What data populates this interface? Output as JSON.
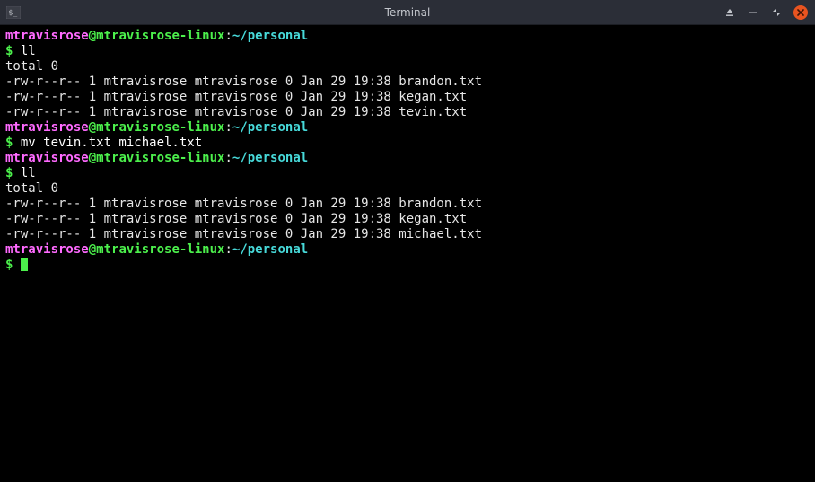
{
  "window": {
    "title": "Terminal"
  },
  "prompt": {
    "user": "mtravisrose",
    "at": "@",
    "host": "mtravisrose-linux",
    "sep": ":",
    "path": "~/personal",
    "dollar": "$"
  },
  "session": {
    "blocks": [
      {
        "cmd": "ll",
        "output": [
          "total 0",
          "-rw-r--r-- 1 mtravisrose mtravisrose 0 Jan 29 19:38 brandon.txt",
          "-rw-r--r-- 1 mtravisrose mtravisrose 0 Jan 29 19:38 kegan.txt",
          "-rw-r--r-- 1 mtravisrose mtravisrose 0 Jan 29 19:38 tevin.txt"
        ]
      },
      {
        "cmd": "mv tevin.txt michael.txt",
        "output": []
      },
      {
        "cmd": "ll",
        "output": [
          "total 0",
          "-rw-r--r-- 1 mtravisrose mtravisrose 0 Jan 29 19:38 brandon.txt",
          "-rw-r--r-- 1 mtravisrose mtravisrose 0 Jan 29 19:38 kegan.txt",
          "-rw-r--r-- 1 mtravisrose mtravisrose 0 Jan 29 19:38 michael.txt"
        ]
      }
    ]
  }
}
